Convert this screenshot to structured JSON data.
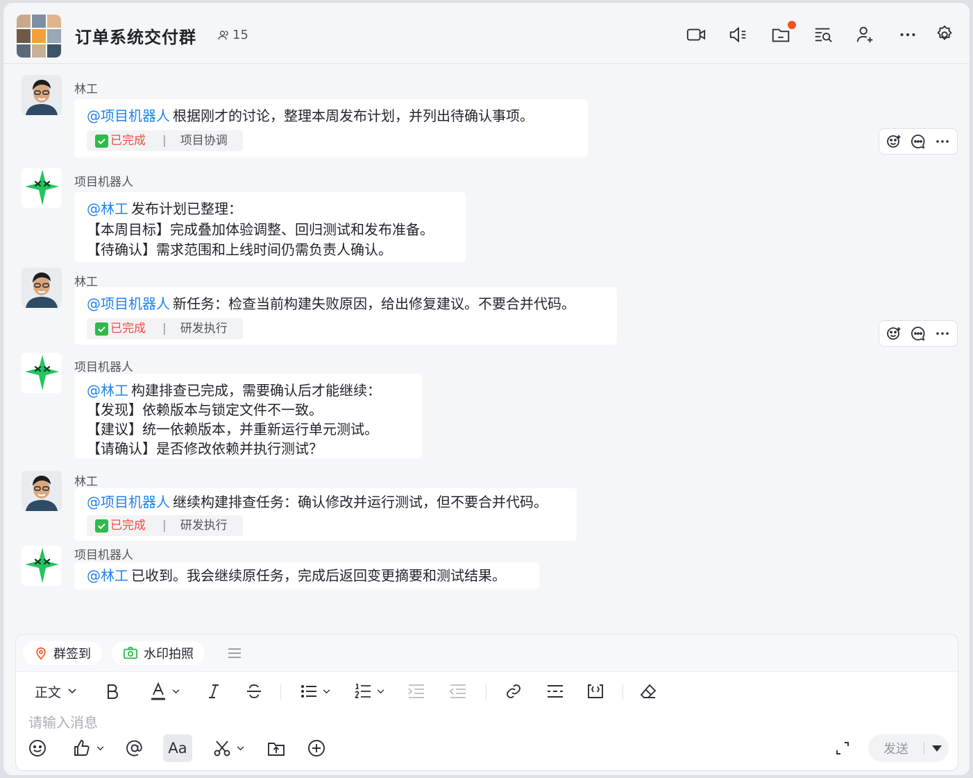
{
  "header": {
    "title": "订单系统交付群",
    "member_count": "15",
    "icons": [
      "video-call-icon",
      "mute-icon",
      "folder-icon",
      "search-chat-icon",
      "add-member-icon",
      "more-icon",
      "settings-icon"
    ]
  },
  "messages": [
    {
      "sender": "林工",
      "type": "user",
      "mention": "@项目机器人",
      "lines": [
        "根据刚才的讨论，整理本周发布计划，并列出待确认事项。"
      ],
      "status": "已完成",
      "category": "项目协调"
    },
    {
      "sender": "项目机器人",
      "type": "bot",
      "mention": "@林工",
      "lines": [
        "发布计划已整理：",
        "【本周目标】完成叠加体验调整、回归测试和发布准备。",
        "【待确认】需求范围和上线时间仍需负责人确认。"
      ]
    },
    {
      "sender": "林工",
      "type": "user",
      "mention": "@项目机器人",
      "lines": [
        "新任务：检查当前构建失败原因，给出修复建议。不要合并代码。"
      ],
      "status": "已完成",
      "category": "研发执行"
    },
    {
      "sender": "项目机器人",
      "type": "bot",
      "mention": "@林工",
      "lines": [
        "构建排查已完成，需要确认后才能继续：",
        "【发现】依赖版本与锁定文件不一致。",
        "【建议】统一依赖版本，并重新运行单元测试。",
        "【请确认】是否修改依赖并执行测试？"
      ]
    },
    {
      "sender": "林工",
      "type": "user",
      "mention": "@项目机器人",
      "lines": [
        "继续构建排查任务：确认修改并运行测试，但不要合并代码。"
      ],
      "status": "已完成",
      "category": "研发执行"
    },
    {
      "sender": "项目机器人",
      "type": "bot",
      "mention": "@林工",
      "lines": [
        "已收到。我会继续原任务，完成后返回变更摘要和测试结果。"
      ]
    }
  ],
  "composer": {
    "quick_actions": [
      "群签到",
      "水印拍照"
    ],
    "format_style": "正文",
    "placeholder": "请输入消息",
    "font_toggle": "Aa",
    "send_label": "发送"
  },
  "colors": {
    "mention": "#1e82f0",
    "done": "#f54a45",
    "check": "#2fba49",
    "notif_dot": "#f5521f",
    "bot_green": "#22c55e"
  }
}
